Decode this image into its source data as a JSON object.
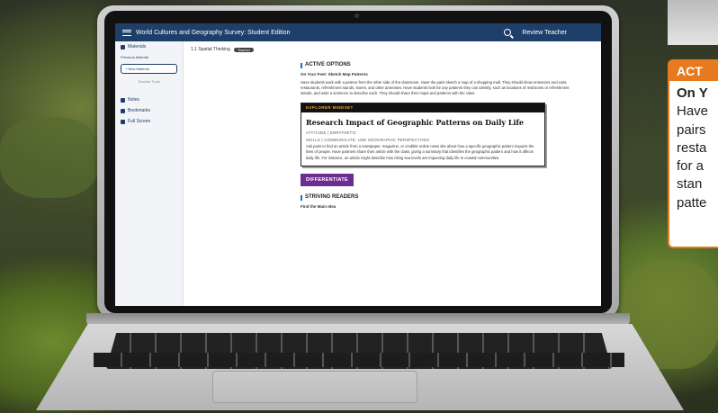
{
  "app": {
    "title": "World Cultures and Geography Survey: Student Edition",
    "user": "Review Teacher"
  },
  "sidebar": {
    "materials": "Materials",
    "previous": "Previous Material",
    "new_material": "+ New Material",
    "teacher_tools": "Teacher Tools",
    "notes": "Notes",
    "bookmarks": "Bookmarks",
    "fullscreen": "Full Screen"
  },
  "breadcrumb": {
    "section": "1.1 Spatial Thinking",
    "badge": "Teacher"
  },
  "active_options": {
    "heading": "ACTIVE OPTIONS",
    "sub": "On Your Feet: Sketch Map Patterns",
    "body": "Have students work with a partner from the other side of the classroom. Have the pairs sketch a map of a shopping mall. They should show entrances and exits, restaurants, refreshment stands, stores, and other amenities. Have students look for any patterns they can identify, such as locations of restrooms or refreshment stands, and write a sentence to describe each. They should share their maps and patterns with the class."
  },
  "explorer": {
    "header": "EXPLORER MINDSET",
    "title": "Research Impact of Geographic Patterns on Daily Life",
    "attitude": "ATTITUDE | EMPATHETIC",
    "skills": "SKILLS | COMMUNICATE, USE GEOGRAPHIC PERSPECTIVES",
    "body": "Ask pairs to find an article from a newspaper, magazine, or credible online news site about how a specific geographic pattern impacts the lives of people. Have partners share their article with the class, giving a summary that identifies the geographic pattern and how it affects daily life. For instance, an article might describe how rising sea levels are impacting daily life in coastal communities."
  },
  "differentiate": "DIFFERENTIATE",
  "striving": {
    "heading": "STRIVING READERS",
    "sub": "Find the Main Idea"
  },
  "callout": {
    "head": "ACT",
    "sub": "On Y",
    "lines": [
      "Have",
      "pairs",
      "resta",
      "for a",
      "stan",
      "patte"
    ]
  }
}
